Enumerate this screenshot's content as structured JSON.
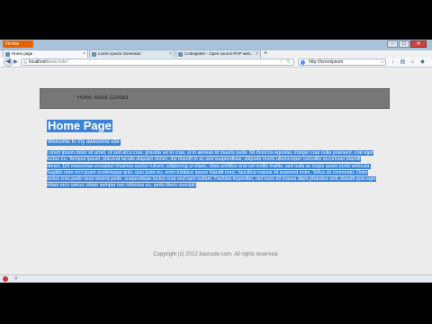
{
  "browser": {
    "menu_button": "Firefox",
    "window_controls": {
      "minimize": "–",
      "maximize": "□",
      "close": "✕"
    },
    "tabs": [
      {
        "title": "Home page",
        "active": true
      },
      {
        "title": "Lorem Ipsum Generator",
        "active": false
      },
      {
        "title": "CodeIgniter - Open source PHP web...",
        "active": false
      }
    ],
    "new_tab": "+",
    "address": {
      "host": "localhost",
      "path": "/basic/site/"
    },
    "search_value": "http://loremipsum",
    "icons": [
      "back-icon",
      "forward-icon",
      "bookmark-star-icon",
      "reload-icon",
      "search-engine-icon",
      "download-icon",
      "bookmarks-icon",
      "home-icon",
      "addon-icon"
    ]
  },
  "site": {
    "nav": [
      "Home",
      "About",
      "Contact"
    ],
    "heading": "Home Page",
    "welcome": "Welcome to my awesome site",
    "body_text": "Lorem ipsum dolor sit amet, ut sed arcu cras, gravida vel in cras, ut in aenean id mauris pede. Mi rhoncus egestas, integer cras nulla praesent, erat eget luctus eu. Tempus ipsum, placerat iaculis aliquam donec, dui blandit in ac sed suspendisse, aliquam morbi ullamcorper convallis accumsan blandit donec. Elit maecenas excepturi vivamus auctor rutrum, adipiscing ut etiam, vitae porttitor erat vel mollis mattis, sed nulla ac turpis quam porta vehicula. Sagittis nam orci quam scelerisque quis, quis justo eu, enim tristique ipsum blandit nunc, faucibus mauris sit euismod enim. Tellus sit commodo. Dolor luctus cras pede risus viverra pede, suspendisse luctus cras sed nam nullam. Facilisis imperdiet, nisl nunc sit massa diam pharetra velit, blandit quis eget etiam arcu varius, etiam semper nec ridiculus eu, pede libero suscipit.",
    "copyright": "Copyright (c) 2012 bascode.com. All rights reserved."
  },
  "statusbar": {
    "close": "×"
  },
  "colors": {
    "selection": "#3b84d8",
    "nav_bg": "#777777",
    "firefox": "#e66000"
  }
}
